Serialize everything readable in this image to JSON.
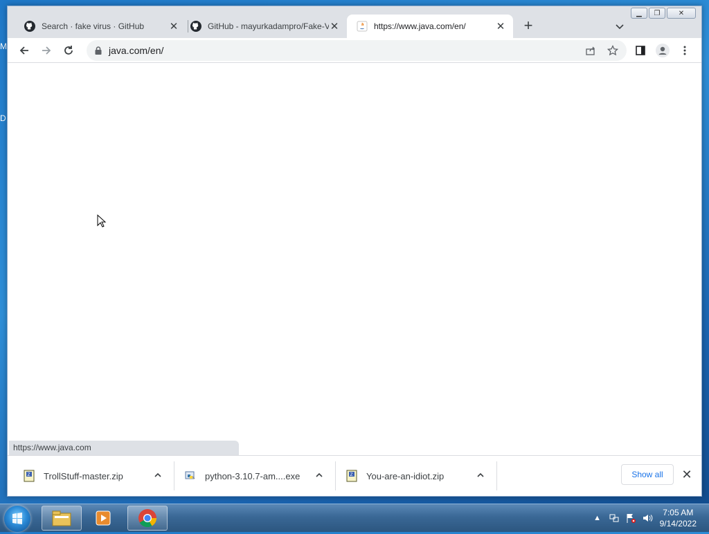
{
  "desktop": {
    "edge_letters": [
      "M",
      "D"
    ]
  },
  "browser": {
    "tabs": [
      {
        "title": "Search · fake virus · GitHub",
        "icon": "github-icon",
        "active": false
      },
      {
        "title": "GitHub - mayurkadampro/Fake-V",
        "icon": "github-icon",
        "active": false
      },
      {
        "title": "https://www.java.com/en/",
        "icon": "java-icon",
        "active": true
      }
    ],
    "address": {
      "url": "java.com/en/"
    },
    "status_url": "https://www.java.com",
    "downloads": [
      {
        "name": "TrollStuff-master.zip",
        "icon": "zip-file-icon"
      },
      {
        "name": "python-3.10.7-am....exe",
        "icon": "installer-file-icon"
      },
      {
        "name": "You-are-an-idiot.zip",
        "icon": "zip-file-icon"
      }
    ],
    "show_all_label": "Show all"
  },
  "taskbar": {
    "time": "7:05 AM",
    "date": "9/14/2022",
    "apps": [
      "file-explorer-icon",
      "media-player-icon",
      "chrome-icon"
    ]
  },
  "colors": {
    "accent": "#1a73e8",
    "tabstrip": "#dee1e6"
  }
}
